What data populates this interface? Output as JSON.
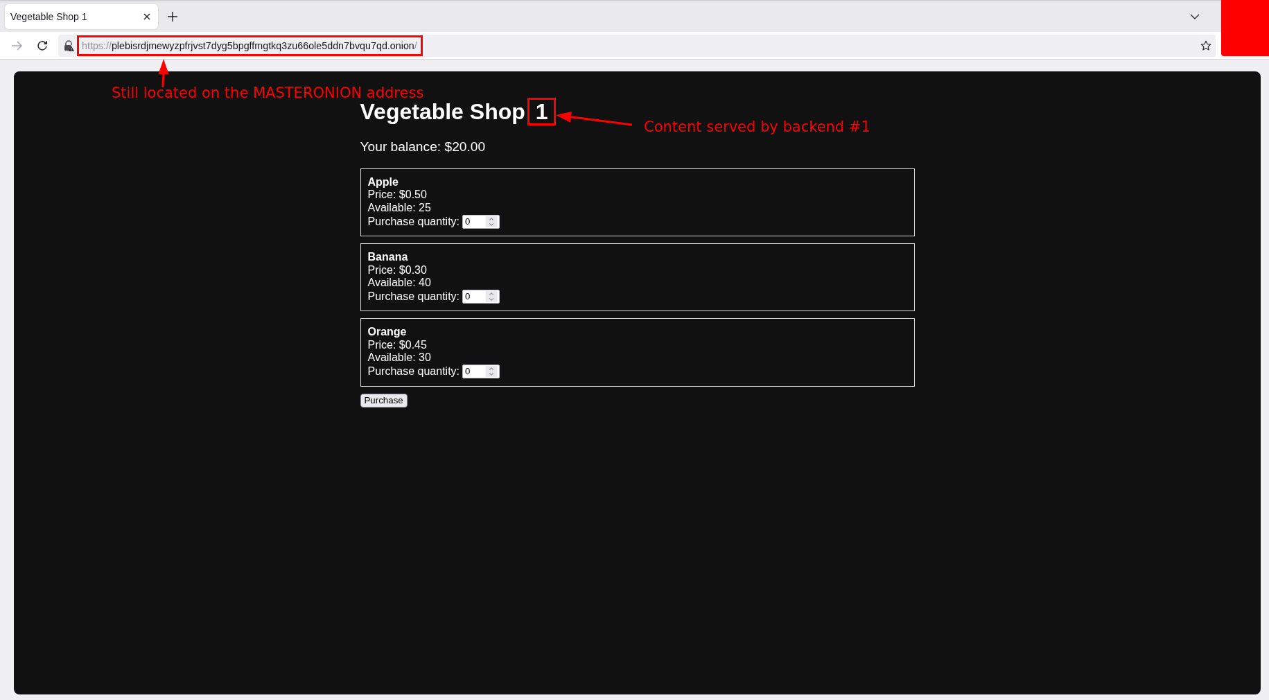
{
  "browser": {
    "tabs": [
      {
        "title": "Vegetable Shop 1",
        "selected": true
      }
    ],
    "forward_disabled": true,
    "address": {
      "scheme": "https://",
      "host": "plebisrdjmewyzpfrjvst7dyg5bpgffmgtkq3zu66ole5ddn7bvqu7qd.onion",
      "path": "/"
    }
  },
  "page": {
    "title": "Vegetable Shop",
    "title_number": "1",
    "balance": "Your balance: $20.00",
    "products": [
      {
        "name": "Apple",
        "price": "Price: $0.50",
        "available": "Available: 25",
        "quantity_label": "Purchase quantity:",
        "quantity": "0"
      },
      {
        "name": "Banana",
        "price": "Price: $0.30",
        "available": "Available: 40",
        "quantity_label": "Purchase quantity:",
        "quantity": "0"
      },
      {
        "name": "Orange",
        "price": "Price: $0.45",
        "available": "Available: 30",
        "quantity_label": "Purchase quantity:",
        "quantity": "0"
      }
    ],
    "purchase_button": "Purchase"
  },
  "annotations": [
    {
      "kind": "address",
      "text": "Still located on the MASTERONION address"
    },
    {
      "kind": "title",
      "text": "Content served by backend #1"
    }
  ]
}
